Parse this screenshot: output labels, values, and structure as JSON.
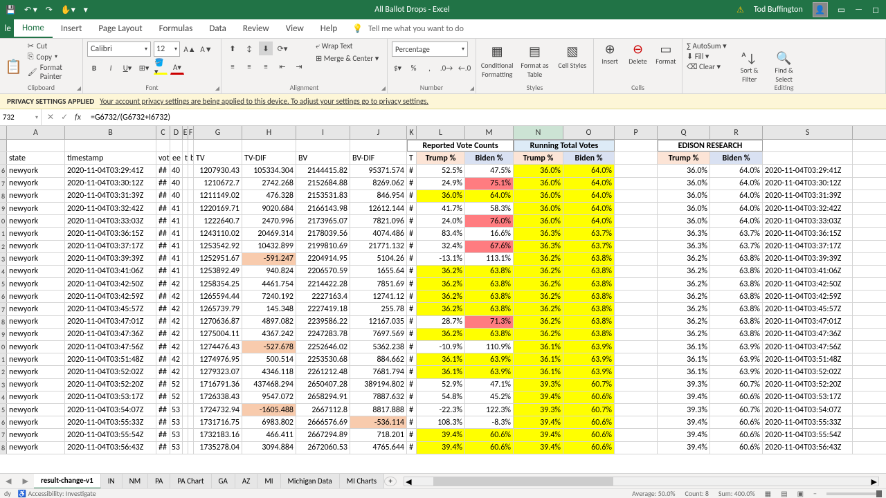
{
  "title": "All Ballot Drops - Excel",
  "user": "Tod Buffington",
  "tabs": {
    "file": "le",
    "home": "Home",
    "insert": "Insert",
    "page_layout": "Page Layout",
    "formulas": "Formulas",
    "data": "Data",
    "review": "Review",
    "view": "View",
    "help": "Help",
    "tellme": "Tell me what you want to do"
  },
  "clipboard": {
    "cut": "Cut",
    "copy": "Copy",
    "painter": "Format Painter",
    "label": "Clipboard"
  },
  "font": {
    "name": "Calibri",
    "size": "12",
    "label": "Font"
  },
  "alignment": {
    "wrap": "Wrap Text",
    "merge": "Merge & Center",
    "label": "Alignment"
  },
  "number": {
    "format": "Percentage",
    "label": "Number"
  },
  "styles": {
    "cond": "Conditional Formatting",
    "table": "Format as Table",
    "cell": "Cell Styles",
    "label": "Styles"
  },
  "cells": {
    "insert": "Insert",
    "delete": "Delete",
    "format": "Format",
    "label": "Cells"
  },
  "editing": {
    "autosum": "AutoSum",
    "fill": "Fill",
    "clear": "Clear",
    "sort": "Sort & Filter",
    "find": "Find & Select",
    "label": "Editing"
  },
  "privacy": {
    "title": "PRIVACY SETTINGS APPLIED",
    "msg": "Your account privacy settings are being applied to this device. To adjust your settings go to privacy settings."
  },
  "namebox": "732",
  "formula": "=G6732/(G6732+I6732)",
  "cols": [
    "A",
    "B",
    "C",
    "D",
    "E",
    "F",
    "G",
    "H",
    "I",
    "J",
    "K",
    "L",
    "M",
    "N",
    "O",
    "P",
    "Q",
    "R",
    "S"
  ],
  "merged": {
    "reported": "Reported Vote Counts",
    "running": "Running Total Votes",
    "edison": "EDISON RESEARCH"
  },
  "headers2": {
    "state": "state",
    "ts": "timestamp",
    "vot": "vot",
    "eev": "ee",
    "t": "t",
    "b": "b",
    "TV": "TV",
    "TVDIF": "TV-DIF",
    "BV": "BV",
    "BVDIF": "BV-DIF",
    "T": "T",
    "trumpPct": "Trump %",
    "bidenPct": "Biden %"
  },
  "rows": [
    {
      "n": "6",
      "st": "newyork",
      "ts": "2020-11-04T03:29:41Z",
      "c": "##",
      "d": "40",
      "tv": "1207930.43",
      "tvd": "105334.304",
      "bv": "2144415.82",
      "bvd": "95371.574",
      "k": "#",
      "l": "52.5%",
      "m": "47.5%",
      "n2": "36.0%",
      "o": "64.0%",
      "q": "36.0%",
      "r": "64.0%",
      "s": "2020-11-04T03:29:41Z",
      "ly": 0,
      "my": 0,
      "mr": 0,
      "tvdp": 0,
      "bvdp": 0
    },
    {
      "n": "7",
      "st": "newyork",
      "ts": "2020-11-04T03:30:12Z",
      "c": "##",
      "d": "40",
      "tv": "1210672.7",
      "tvd": "2742.268",
      "bv": "2152684.88",
      "bvd": "8269.062",
      "k": "#",
      "l": "24.9%",
      "m": "75.1%",
      "n2": "36.0%",
      "o": "64.0%",
      "q": "36.0%",
      "r": "64.0%",
      "s": "2020-11-04T03:30:12Z",
      "ly": 0,
      "my": 0,
      "mr": 1,
      "tvdp": 0,
      "bvdp": 0
    },
    {
      "n": "8",
      "st": "newyork",
      "ts": "2020-11-04T03:31:39Z",
      "c": "##",
      "d": "40",
      "tv": "1211149.02",
      "tvd": "476.328",
      "bv": "2153531.83",
      "bvd": "846.954",
      "k": "#",
      "l": "36.0%",
      "m": "64.0%",
      "n2": "36.0%",
      "o": "64.0%",
      "q": "36.0%",
      "r": "64.0%",
      "s": "2020-11-04T03:31:39Z",
      "ly": 1,
      "my": 1,
      "mr": 0,
      "tvdp": 0,
      "bvdp": 0
    },
    {
      "n": "9",
      "st": "newyork",
      "ts": "2020-11-04T03:32:42Z",
      "c": "##",
      "d": "41",
      "tv": "1220169.71",
      "tvd": "9020.684",
      "bv": "2166143.98",
      "bvd": "12612.144",
      "k": "#",
      "l": "41.7%",
      "m": "58.3%",
      "n2": "36.0%",
      "o": "64.0%",
      "q": "36.0%",
      "r": "64.0%",
      "s": "2020-11-04T03:32:42Z",
      "ly": 0,
      "my": 0,
      "mr": 0,
      "tvdp": 0,
      "bvdp": 0
    },
    {
      "n": "0",
      "st": "newyork",
      "ts": "2020-11-04T03:33:03Z",
      "c": "##",
      "d": "41",
      "tv": "1222640.7",
      "tvd": "2470.996",
      "bv": "2173965.07",
      "bvd": "7821.096",
      "k": "#",
      "l": "24.0%",
      "m": "76.0%",
      "n2": "36.0%",
      "o": "64.0%",
      "q": "36.0%",
      "r": "64.0%",
      "s": "2020-11-04T03:33:03Z",
      "ly": 0,
      "my": 0,
      "mr": 1,
      "tvdp": 0,
      "bvdp": 0
    },
    {
      "n": "1",
      "st": "newyork",
      "ts": "2020-11-04T03:36:15Z",
      "c": "##",
      "d": "41",
      "tv": "1243110.02",
      "tvd": "20469.314",
      "bv": "2178039.56",
      "bvd": "4074.486",
      "k": "#",
      "l": "83.4%",
      "m": "16.6%",
      "n2": "36.3%",
      "o": "63.7%",
      "q": "36.3%",
      "r": "63.7%",
      "s": "2020-11-04T03:36:15Z",
      "ly": 0,
      "my": 0,
      "mr": 0,
      "tvdp": 0,
      "bvdp": 0
    },
    {
      "n": "2",
      "st": "newyork",
      "ts": "2020-11-04T03:37:17Z",
      "c": "##",
      "d": "41",
      "tv": "1253542.92",
      "tvd": "10432.899",
      "bv": "2199810.69",
      "bvd": "21771.132",
      "k": "#",
      "l": "32.4%",
      "m": "67.6%",
      "n2": "36.3%",
      "o": "63.7%",
      "q": "36.3%",
      "r": "63.7%",
      "s": "2020-11-04T03:37:17Z",
      "ly": 0,
      "my": 0,
      "mr": 1,
      "tvdp": 0,
      "bvdp": 0
    },
    {
      "n": "3",
      "st": "newyork",
      "ts": "2020-11-04T03:39:39Z",
      "c": "##",
      "d": "41",
      "tv": "1252951.67",
      "tvd": "-591.247",
      "bv": "2204914.95",
      "bvd": "5104.26",
      "k": "#",
      "l": "-13.1%",
      "m": "113.1%",
      "n2": "36.2%",
      "o": "63.8%",
      "q": "36.2%",
      "r": "63.8%",
      "s": "2020-11-04T03:39:39Z",
      "ly": 0,
      "my": 0,
      "mr": 0,
      "tvdp": 1,
      "bvdp": 0
    },
    {
      "n": "4",
      "st": "newyork",
      "ts": "2020-11-04T03:41:06Z",
      "c": "##",
      "d": "41",
      "tv": "1253892.49",
      "tvd": "940.824",
      "bv": "2206570.59",
      "bvd": "1655.64",
      "k": "#",
      "l": "36.2%",
      "m": "63.8%",
      "n2": "36.2%",
      "o": "63.8%",
      "q": "36.2%",
      "r": "63.8%",
      "s": "2020-11-04T03:41:06Z",
      "ly": 1,
      "my": 1,
      "mr": 0,
      "tvdp": 0,
      "bvdp": 0
    },
    {
      "n": "5",
      "st": "newyork",
      "ts": "2020-11-04T03:42:50Z",
      "c": "##",
      "d": "42",
      "tv": "1258354.25",
      "tvd": "4461.754",
      "bv": "2214422.28",
      "bvd": "7851.69",
      "k": "#",
      "l": "36.2%",
      "m": "63.8%",
      "n2": "36.2%",
      "o": "63.8%",
      "q": "36.2%",
      "r": "63.8%",
      "s": "2020-11-04T03:42:50Z",
      "ly": 1,
      "my": 1,
      "mr": 0,
      "tvdp": 0,
      "bvdp": 0
    },
    {
      "n": "6",
      "st": "newyork",
      "ts": "2020-11-04T03:42:59Z",
      "c": "##",
      "d": "42",
      "tv": "1265594.44",
      "tvd": "7240.192",
      "bv": "2227163.4",
      "bvd": "12741.12",
      "k": "#",
      "l": "36.2%",
      "m": "63.8%",
      "n2": "36.2%",
      "o": "63.8%",
      "q": "36.2%",
      "r": "63.8%",
      "s": "2020-11-04T03:42:59Z",
      "ly": 1,
      "my": 1,
      "mr": 0,
      "tvdp": 0,
      "bvdp": 0
    },
    {
      "n": "7",
      "st": "newyork",
      "ts": "2020-11-04T03:45:57Z",
      "c": "##",
      "d": "42",
      "tv": "1265739.79",
      "tvd": "145.348",
      "bv": "2227419.18",
      "bvd": "255.78",
      "k": "#",
      "l": "36.2%",
      "m": "63.8%",
      "n2": "36.2%",
      "o": "63.8%",
      "q": "36.2%",
      "r": "63.8%",
      "s": "2020-11-04T03:45:57Z",
      "ly": 1,
      "my": 1,
      "mr": 0,
      "tvdp": 0,
      "bvdp": 0
    },
    {
      "n": "8",
      "st": "newyork",
      "ts": "2020-11-04T03:47:01Z",
      "c": "##",
      "d": "42",
      "tv": "1270636.87",
      "tvd": "4897.082",
      "bv": "2239586.22",
      "bvd": "12167.035",
      "k": "#",
      "l": "28.7%",
      "m": "71.3%",
      "n2": "36.2%",
      "o": "63.8%",
      "q": "36.2%",
      "r": "63.8%",
      "s": "2020-11-04T03:47:01Z",
      "ly": 0,
      "my": 0,
      "mr": 1,
      "tvdp": 0,
      "bvdp": 0
    },
    {
      "n": "9",
      "st": "newyork",
      "ts": "2020-11-04T03:47:36Z",
      "c": "##",
      "d": "42",
      "tv": "1275004.11",
      "tvd": "4367.242",
      "bv": "2247283.78",
      "bvd": "7697.569",
      "k": "#",
      "l": "36.2%",
      "m": "63.8%",
      "n2": "36.2%",
      "o": "63.8%",
      "q": "36.2%",
      "r": "63.8%",
      "s": "2020-11-04T03:47:36Z",
      "ly": 1,
      "my": 1,
      "mr": 0,
      "tvdp": 0,
      "bvdp": 0
    },
    {
      "n": "0",
      "st": "newyork",
      "ts": "2020-11-04T03:47:56Z",
      "c": "##",
      "d": "42",
      "tv": "1274476.43",
      "tvd": "-527.678",
      "bv": "2252646.02",
      "bvd": "5362.238",
      "k": "#",
      "l": "-10.9%",
      "m": "110.9%",
      "n2": "36.1%",
      "o": "63.9%",
      "q": "36.1%",
      "r": "63.9%",
      "s": "2020-11-04T03:47:56Z",
      "ly": 0,
      "my": 0,
      "mr": 0,
      "tvdp": 1,
      "bvdp": 0
    },
    {
      "n": "1",
      "st": "newyork",
      "ts": "2020-11-04T03:51:48Z",
      "c": "##",
      "d": "42",
      "tv": "1274976.95",
      "tvd": "500.514",
      "bv": "2253530.68",
      "bvd": "884.662",
      "k": "#",
      "l": "36.1%",
      "m": "63.9%",
      "n2": "36.1%",
      "o": "63.9%",
      "q": "36.1%",
      "r": "63.9%",
      "s": "2020-11-04T03:51:48Z",
      "ly": 1,
      "my": 1,
      "mr": 0,
      "tvdp": 0,
      "bvdp": 0
    },
    {
      "n": "2",
      "st": "newyork",
      "ts": "2020-11-04T03:52:02Z",
      "c": "##",
      "d": "42",
      "tv": "1279323.07",
      "tvd": "4346.118",
      "bv": "2261212.48",
      "bvd": "7681.794",
      "k": "#",
      "l": "36.1%",
      "m": "63.9%",
      "n2": "36.1%",
      "o": "63.9%",
      "q": "36.1%",
      "r": "63.9%",
      "s": "2020-11-04T03:52:02Z",
      "ly": 1,
      "my": 1,
      "mr": 0,
      "tvdp": 0,
      "bvdp": 0
    },
    {
      "n": "3",
      "st": "newyork",
      "ts": "2020-11-04T03:52:20Z",
      "c": "##",
      "d": "52",
      "tv": "1716791.36",
      "tvd": "437468.294",
      "bv": "2650407.28",
      "bvd": "389194.802",
      "k": "#",
      "l": "52.9%",
      "m": "47.1%",
      "n2": "39.3%",
      "o": "60.7%",
      "q": "39.3%",
      "r": "60.7%",
      "s": "2020-11-04T03:52:20Z",
      "ly": 0,
      "my": 0,
      "mr": 0,
      "tvdp": 0,
      "bvdp": 0
    },
    {
      "n": "4",
      "st": "newyork",
      "ts": "2020-11-04T03:53:17Z",
      "c": "##",
      "d": "52",
      "tv": "1726338.43",
      "tvd": "9547.072",
      "bv": "2658294.91",
      "bvd": "7887.632",
      "k": "#",
      "l": "54.8%",
      "m": "45.2%",
      "n2": "39.4%",
      "o": "60.6%",
      "q": "39.4%",
      "r": "60.6%",
      "s": "2020-11-04T03:53:17Z",
      "ly": 0,
      "my": 0,
      "mr": 0,
      "tvdp": 0,
      "bvdp": 0
    },
    {
      "n": "5",
      "st": "newyork",
      "ts": "2020-11-04T03:54:07Z",
      "c": "##",
      "d": "53",
      "tv": "1724732.94",
      "tvd": "-1605.488",
      "bv": "2667112.8",
      "bvd": "8817.888",
      "k": "#",
      "l": "-22.3%",
      "m": "122.3%",
      "n2": "39.3%",
      "o": "60.7%",
      "q": "39.3%",
      "r": "60.7%",
      "s": "2020-11-04T03:54:07Z",
      "ly": 0,
      "my": 0,
      "mr": 0,
      "tvdp": 1,
      "bvdp": 0
    },
    {
      "n": "6",
      "st": "newyork",
      "ts": "2020-11-04T03:55:33Z",
      "c": "##",
      "d": "53",
      "tv": "1731716.75",
      "tvd": "6983.802",
      "bv": "2666576.69",
      "bvd": "-536.114",
      "k": "#",
      "l": "108.3%",
      "m": "-8.3%",
      "n2": "39.4%",
      "o": "60.6%",
      "q": "39.4%",
      "r": "60.6%",
      "s": "2020-11-04T03:55:33Z",
      "ly": 0,
      "my": 0,
      "mr": 0,
      "tvdp": 0,
      "bvdp": 1
    },
    {
      "n": "7",
      "st": "newyork",
      "ts": "2020-11-04T03:55:54Z",
      "c": "##",
      "d": "53",
      "tv": "1732183.16",
      "tvd": "466.411",
      "bv": "2667294.89",
      "bvd": "718.201",
      "k": "#",
      "l": "39.4%",
      "m": "60.6%",
      "n2": "39.4%",
      "o": "60.6%",
      "q": "39.4%",
      "r": "60.6%",
      "s": "2020-11-04T03:55:54Z",
      "ly": 1,
      "my": 1,
      "mr": 0,
      "tvdp": 0,
      "bvdp": 0
    },
    {
      "n": "8",
      "st": "newyork",
      "ts": "2020-11-04T03:56:43Z",
      "c": "##",
      "d": "53",
      "tv": "1735278.04",
      "tvd": "3094.884",
      "bv": "2672060.53",
      "bvd": "4765.644",
      "k": "#",
      "l": "39.4%",
      "m": "60.6%",
      "n2": "39.4%",
      "o": "60.6%",
      "q": "39.4%",
      "r": "60.6%",
      "s": "2020-11-04T03:56:43Z",
      "ly": 1,
      "my": 1,
      "mr": 0,
      "tvdp": 0,
      "bvdp": 0
    }
  ],
  "sheets": [
    "result-change-v1",
    "IN",
    "NM",
    "PA",
    "PA Chart",
    "GA",
    "AZ",
    "MI",
    "Michigan Data",
    "MI Charts"
  ],
  "status": {
    "ready": "dy",
    "acc": "Accessibility: Investigate",
    "avg": "Average: 50.0%",
    "count": "Count: 8",
    "sum": "Sum: 400.0%"
  }
}
